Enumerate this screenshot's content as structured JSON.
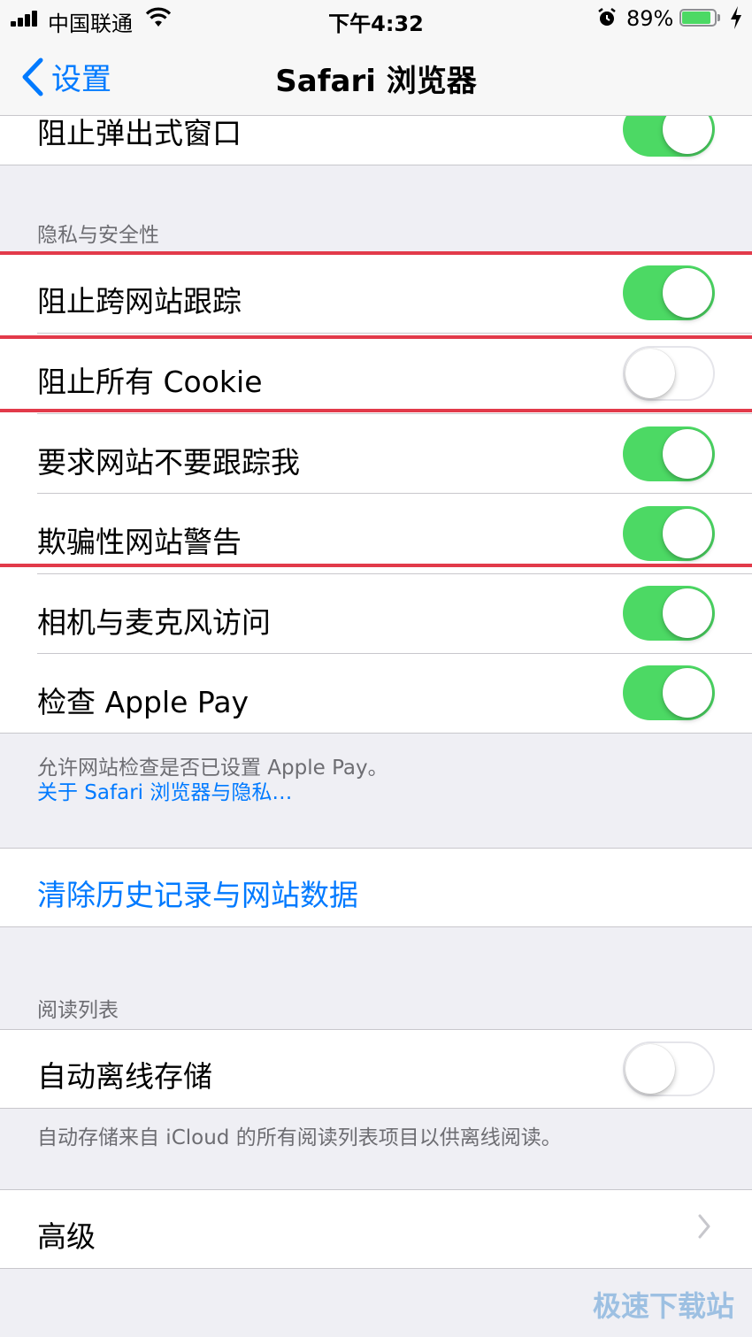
{
  "status_bar": {
    "carrier": "中国联通",
    "time": "下午4:32",
    "battery_percent": "89%",
    "battery_level": 0.89,
    "icons": [
      "signal-icon",
      "wifi-icon",
      "alarm-icon",
      "battery-icon",
      "charging-icon"
    ]
  },
  "nav": {
    "back_label": "设置",
    "title": "Safari 浏览器"
  },
  "rows": {
    "block_popups": {
      "label": "阻止弹出式窗口",
      "on": true
    },
    "cross_site_tracking": {
      "label": "阻止跨网站跟踪",
      "on": true
    },
    "block_cookies": {
      "label": "阻止所有 Cookie",
      "on": false
    },
    "do_not_track": {
      "label": "要求网站不要跟踪我",
      "on": true
    },
    "fraud_warning": {
      "label": "欺骗性网站警告",
      "on": true
    },
    "camera_mic": {
      "label": "相机与麦克风访问",
      "on": true
    },
    "apple_pay": {
      "label": "检查 Apple Pay",
      "on": true
    },
    "offline_storage": {
      "label": "自动离线存储",
      "on": false
    },
    "advanced": {
      "label": "高级"
    }
  },
  "sections": {
    "privacy_header": "隐私与安全性",
    "privacy_footer": "允许网站检查是否已设置 Apple Pay。",
    "privacy_link": "关于 Safari 浏览器与隐私…",
    "clear_history": "清除历史记录与网站数据",
    "reading_list_header": "阅读列表",
    "reading_list_footer": "自动存储来自 iCloud 的所有阅读列表项目以供离线阅读。"
  },
  "colors": {
    "accent": "#007aff",
    "toggle_on": "#4cd964",
    "highlight": "#e23a4a"
  },
  "watermark": "极速下载站"
}
